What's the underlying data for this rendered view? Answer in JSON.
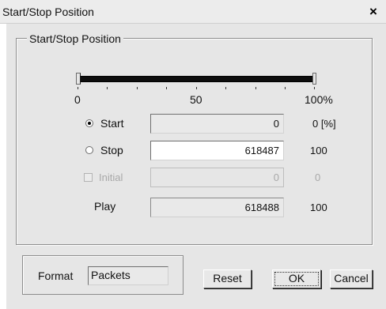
{
  "window": {
    "title": "Start/Stop Position",
    "close_glyph": "×"
  },
  "group": {
    "legend": "Start/Stop Position"
  },
  "slider": {
    "start_fraction": 0.0,
    "stop_fraction": 1.0,
    "tick_labels": [
      "0",
      "50",
      "100%"
    ]
  },
  "options": {
    "start": {
      "label": "Start",
      "value": "0",
      "extra": "0  [%]",
      "checked": true
    },
    "stop": {
      "label": "Stop",
      "value": "618487",
      "extra": "100",
      "checked": false
    },
    "initial": {
      "label": "Initial",
      "value": "0",
      "extra": "0",
      "enabled": false
    },
    "play": {
      "label": "Play",
      "value": "618488",
      "extra": "100"
    }
  },
  "format": {
    "label": "Format",
    "value": "Packets"
  },
  "buttons": {
    "reset": "Reset",
    "ok": "OK",
    "cancel": "Cancel"
  }
}
